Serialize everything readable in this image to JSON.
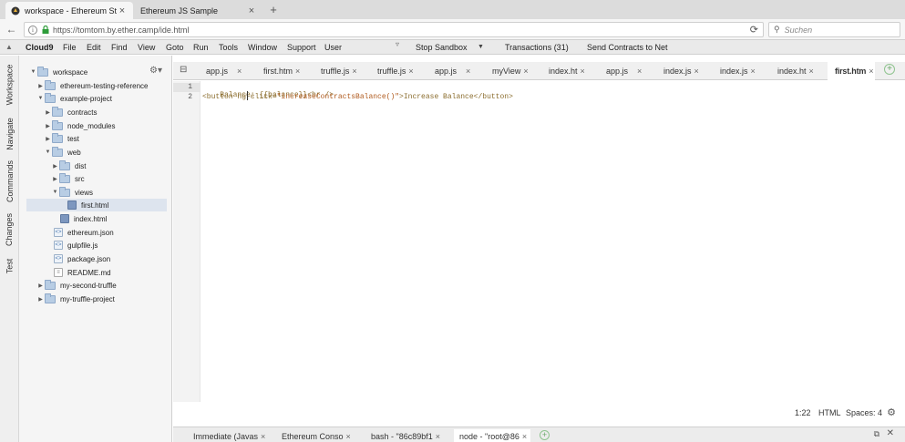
{
  "browser": {
    "tabs": [
      {
        "label": "workspace - Ethereum Stu..."
      },
      {
        "label": "Ethereum JS Sample"
      }
    ],
    "url": "https://tomtom.by.ether.camp/ide.html",
    "search_placeholder": "Suchen"
  },
  "menubar": {
    "brand": "Cloud9",
    "items": [
      "File",
      "Edit",
      "Find",
      "View",
      "Goto",
      "Run",
      "Tools",
      "Window",
      "Support",
      "User"
    ],
    "stop_sandbox": "Stop Sandbox",
    "transactions": "Transactions (31)",
    "send_contracts": "Send Contracts to Net"
  },
  "sidetabs": [
    "Workspace",
    "Navigate",
    "Commands",
    "Changes",
    "Test"
  ],
  "tree": {
    "root": "workspace",
    "items": [
      {
        "label": "ethereum-testing-reference"
      },
      {
        "label": "example-project"
      },
      {
        "label": "contracts"
      },
      {
        "label": "node_modules"
      },
      {
        "label": "test"
      },
      {
        "label": "web"
      },
      {
        "label": "dist"
      },
      {
        "label": "src"
      },
      {
        "label": "views"
      },
      {
        "label": "first.html"
      },
      {
        "label": "index.html"
      },
      {
        "label": "ethereum.json"
      },
      {
        "label": "gulpfile.js"
      },
      {
        "label": "package.json"
      },
      {
        "label": "README.md"
      },
      {
        "label": "my-second-truffle"
      },
      {
        "label": "my-truffle-project"
      }
    ]
  },
  "editor_tabs": [
    "app.js",
    "first.htm",
    "truffle.js",
    "truffle.js",
    "app.js",
    "myView",
    "index.ht",
    "app.js",
    "index.js",
    "index.js",
    "index.ht",
    "first.htm"
  ],
  "code": {
    "line_numbers": [
      "1",
      "2"
    ],
    "line1_text": "Balance: {{balance}}<br />",
    "line2_tag_open": "<button ",
    "line2_attr": "ng-click=",
    "line2_value": "\"increaseContractsBalance()\"",
    "line2_rest": ">Increase Balance</button>"
  },
  "statusbar": {
    "position": "1:22",
    "mode": "HTML",
    "spaces": "Spaces: 4"
  },
  "console_tabs": [
    "Immediate (Javas",
    "Ethereum Conso",
    "bash - \"86c89bf1",
    "node - \"root@86"
  ]
}
